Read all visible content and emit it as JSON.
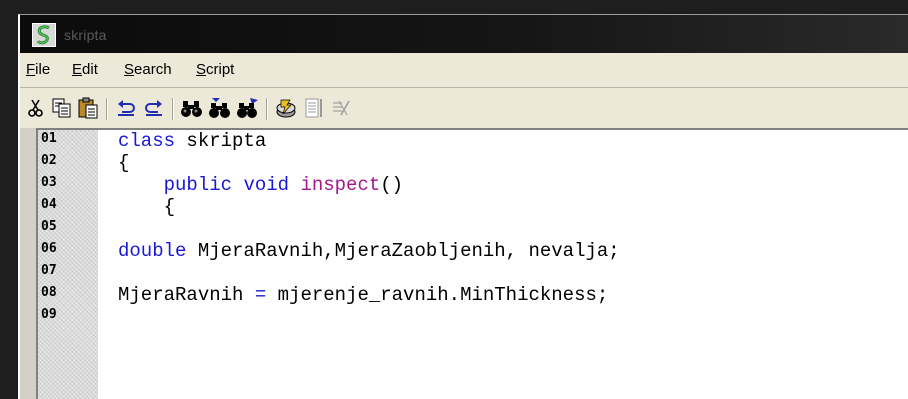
{
  "window": {
    "title": "skripta"
  },
  "menu": [
    {
      "mnemonic": "F",
      "rest": "ile"
    },
    {
      "mnemonic": "E",
      "rest": "dit"
    },
    {
      "mnemonic": "S",
      "rest": "earch"
    },
    {
      "mnemonic": "S",
      "rest": "cript"
    }
  ],
  "toolbar": {
    "icons": [
      "cut-icon",
      "copy-icon",
      "paste-icon",
      "undo-icon",
      "redo-icon",
      "find-icon",
      "find-next-icon",
      "replace-icon",
      "compile-icon",
      "script-list-icon",
      "disabled-tool-icon"
    ]
  },
  "editor": {
    "line_numbers": [
      "01",
      "02",
      "03",
      "04",
      "05",
      "06",
      "07",
      "08",
      "09"
    ],
    "lines": [
      {
        "a": "class",
        "b": " skripta"
      },
      {
        "a": "{"
      },
      {
        "indent": "    ",
        "kw1": "public",
        "sp1": " ",
        "kw2": "void",
        "sp2": " ",
        "fn": "inspect",
        "rest": "()"
      },
      {
        "indent": "    ",
        "rest": "{"
      },
      {
        "rest": ""
      },
      {
        "kw": "double",
        "rest": " MjeraRavnih,MjeraZaobljenih, nevalja;"
      },
      {
        "rest": ""
      },
      {
        "pre": "MjeraRavnih ",
        "op": "=",
        "post": " mjerenje_ravnih.MinThickness;"
      },
      {
        "rest": ""
      }
    ]
  },
  "colors": {
    "keyword": "#1a18d8",
    "function": "#a3188f"
  }
}
